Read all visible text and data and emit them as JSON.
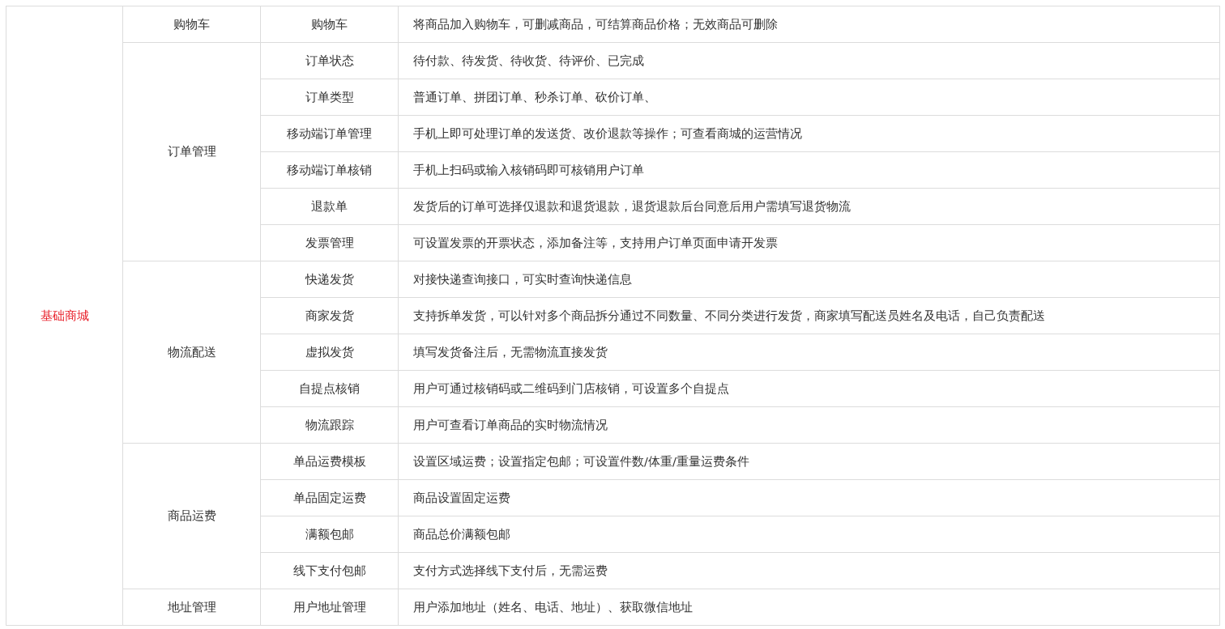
{
  "module": "基础商城",
  "groups": [
    {
      "name": "购物车",
      "features": [
        {
          "name": "购物车",
          "description": "将商品加入购物车，可删减商品，可结算商品价格；无效商品可删除"
        }
      ]
    },
    {
      "name": "订单管理",
      "features": [
        {
          "name": "订单状态",
          "description": "待付款、待发货、待收货、待评价、已完成"
        },
        {
          "name": "订单类型",
          "description": "普通订单、拼团订单、秒杀订单、砍价订单、"
        },
        {
          "name": "移动端订单管理",
          "description": "手机上即可处理订单的发送货、改价退款等操作；可查看商城的运营情况"
        },
        {
          "name": "移动端订单核销",
          "description": "手机上扫码或输入核销码即可核销用户订单"
        },
        {
          "name": "退款单",
          "description": "发货后的订单可选择仅退款和退货退款，退货退款后台同意后用户需填写退货物流"
        },
        {
          "name": "发票管理",
          "description": "可设置发票的开票状态，添加备注等，支持用户订单页面申请开发票"
        }
      ]
    },
    {
      "name": "物流配送",
      "features": [
        {
          "name": "快递发货",
          "description": "对接快递查询接口，可实时查询快递信息"
        },
        {
          "name": "商家发货",
          "description": "支持拆单发货，可以针对多个商品拆分通过不同数量、不同分类进行发货，商家填写配送员姓名及电话，自己负责配送"
        },
        {
          "name": "虚拟发货",
          "description": "填写发货备注后，无需物流直接发货"
        },
        {
          "name": "自提点核销",
          "description": "用户可通过核销码或二维码到门店核销，可设置多个自提点"
        },
        {
          "name": "物流跟踪",
          "description": "用户可查看订单商品的实时物流情况"
        }
      ]
    },
    {
      "name": "商品运费",
      "features": [
        {
          "name": "单品运费模板",
          "description": "设置区域运费；设置指定包邮；可设置件数/体重/重量运费条件"
        },
        {
          "name": "单品固定运费",
          "description": "商品设置固定运费"
        },
        {
          "name": "满额包邮",
          "description": "商品总价满额包邮"
        },
        {
          "name": "线下支付包邮",
          "description": "支付方式选择线下支付后，无需运费"
        }
      ]
    },
    {
      "name": "地址管理",
      "features": [
        {
          "name": "用户地址管理",
          "description": "用户添加地址（姓名、电话、地址）、获取微信地址"
        }
      ]
    }
  ]
}
